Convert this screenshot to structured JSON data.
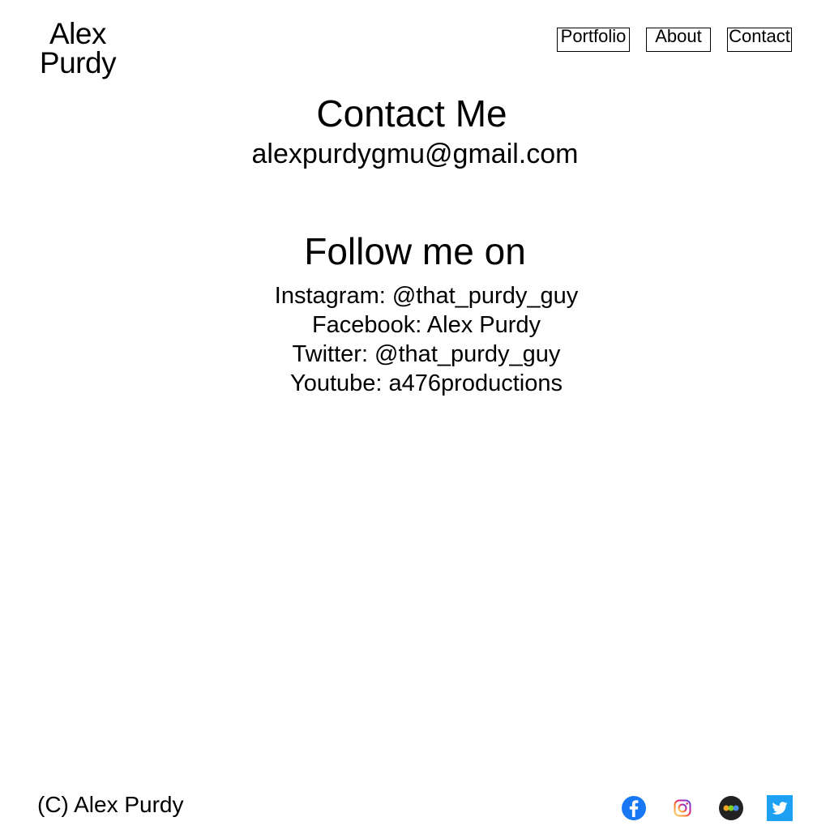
{
  "header": {
    "logo_line1": "Alex",
    "logo_line2": "Purdy",
    "nav": [
      {
        "label": "Portfolio"
      },
      {
        "label": "About"
      },
      {
        "label": "Contact"
      }
    ]
  },
  "main": {
    "contact_title": "Contact Me",
    "email": "alexpurdygmu@gmail.com",
    "follow_title": "Follow me on",
    "social_lines": [
      "Instagram: @that_purdy_guy",
      "Facebook: Alex Purdy",
      "Twitter: @that_purdy_guy",
      "Youtube: a476productions"
    ]
  },
  "footer": {
    "copyright": "(C) Alex Purdy",
    "icons": [
      {
        "name": "facebook-icon",
        "color": "#1877F2"
      },
      {
        "name": "instagram-icon",
        "color": "#C13584"
      },
      {
        "name": "medium-icon",
        "color": "#222222"
      },
      {
        "name": "twitter-icon",
        "color": "#1DA1F2"
      }
    ]
  }
}
